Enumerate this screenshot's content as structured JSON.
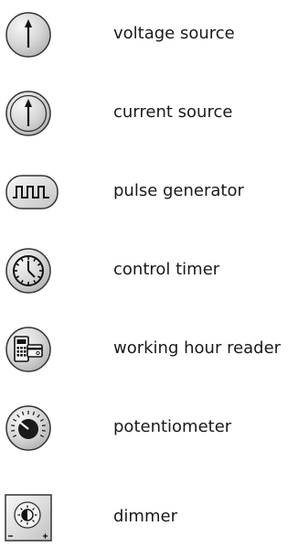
{
  "symbols": [
    {
      "label": "voltage source",
      "icon": "voltage-source-icon"
    },
    {
      "label": "current source",
      "icon": "current-source-icon"
    },
    {
      "label": "pulse generator",
      "icon": "pulse-generator-icon"
    },
    {
      "label": "control timer",
      "icon": "control-timer-icon"
    },
    {
      "label": "working hour reader",
      "icon": "working-hour-reader-icon"
    },
    {
      "label": "potentiometer",
      "icon": "potentiometer-icon"
    },
    {
      "label": "dimmer",
      "icon": "dimmer-icon"
    }
  ],
  "colors": {
    "fill_light": "#f4f4f4",
    "fill_dark": "#b9b9b9",
    "stroke": "#222222",
    "text": "#1a1a1a"
  }
}
